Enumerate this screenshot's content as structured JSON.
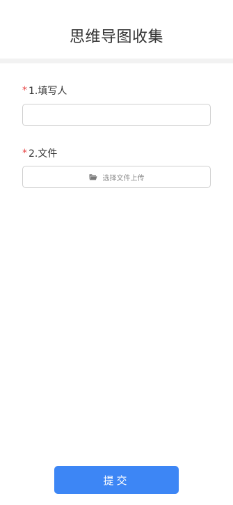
{
  "header": {
    "title": "思维导图收集"
  },
  "form": {
    "required_mark": "*",
    "fields": [
      {
        "label": "1.填写人",
        "type": "text",
        "value": "",
        "placeholder": ""
      },
      {
        "label": "2.文件",
        "type": "file",
        "button_label": "选择文件上传",
        "icon": "folder-open-icon"
      }
    ]
  },
  "footer": {
    "submit_label": "提交"
  },
  "colors": {
    "accent": "#3d86f5",
    "required": "#e84a4a",
    "divider": "#f2f2f2"
  }
}
